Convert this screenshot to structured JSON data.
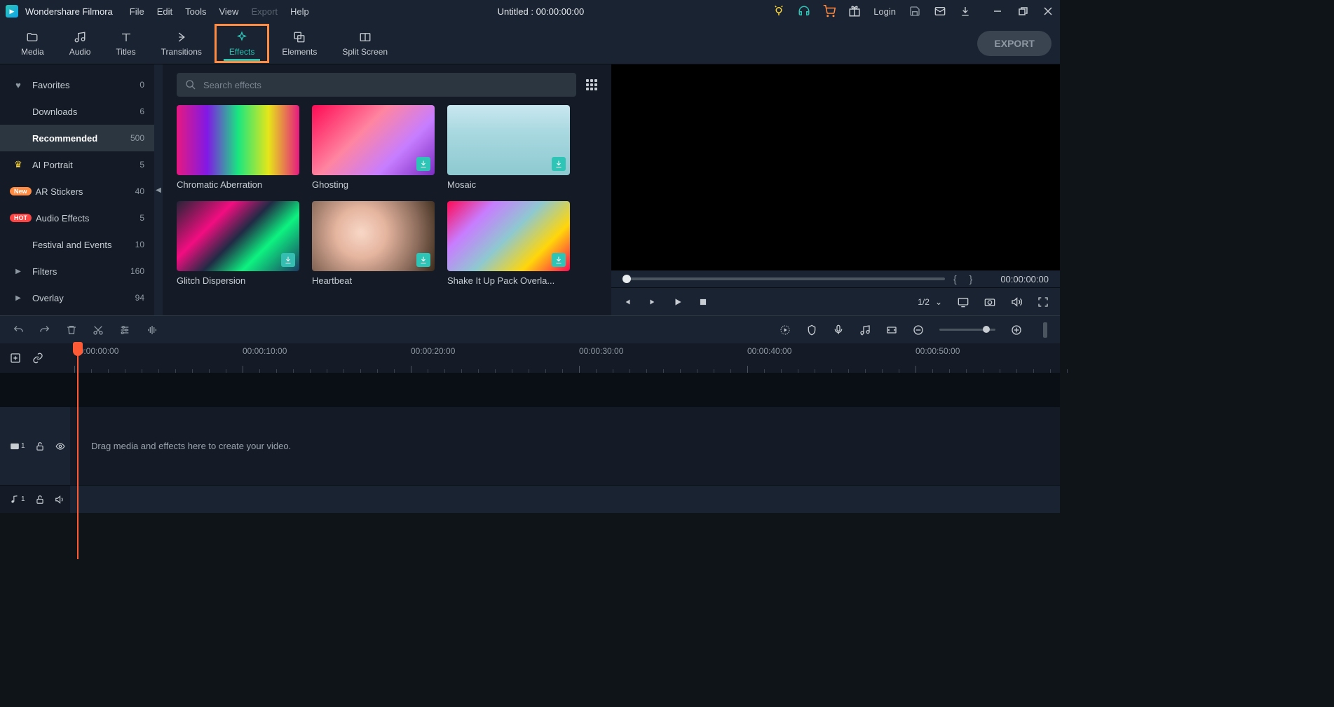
{
  "app": {
    "name": "Wondershare Filmora",
    "title": "Untitled : 00:00:00:00"
  },
  "menu": {
    "items": [
      "File",
      "Edit",
      "Tools",
      "View",
      "Export",
      "Help"
    ],
    "disabled_index": 4
  },
  "titlebar": {
    "login": "Login"
  },
  "tabs": [
    {
      "label": "Media",
      "icon": "folder"
    },
    {
      "label": "Audio",
      "icon": "music"
    },
    {
      "label": "Titles",
      "icon": "type"
    },
    {
      "label": "Transitions",
      "icon": "transitions"
    },
    {
      "label": "Effects",
      "icon": "sparkle",
      "active": true
    },
    {
      "label": "Elements",
      "icon": "layers"
    },
    {
      "label": "Split Screen",
      "icon": "split"
    }
  ],
  "export_label": "EXPORT",
  "sidebar": [
    {
      "icon": "heart",
      "label": "Favorites",
      "count": "0"
    },
    {
      "label": "Downloads",
      "count": "6"
    },
    {
      "label": "Recommended",
      "count": "500",
      "selected": true
    },
    {
      "icon": "crown",
      "label": "AI Portrait",
      "count": "5"
    },
    {
      "badge": "New",
      "badge_class": "new",
      "label": "AR Stickers",
      "count": "40"
    },
    {
      "badge": "HOT",
      "badge_class": "hot",
      "label": "Audio Effects",
      "count": "5"
    },
    {
      "label": "Festival and Events",
      "count": "10"
    },
    {
      "icon": "chevron",
      "label": "Filters",
      "count": "160"
    },
    {
      "icon": "chevron",
      "label": "Overlay",
      "count": "94"
    }
  ],
  "search": {
    "placeholder": "Search effects"
  },
  "effects": [
    {
      "label": "Chromatic Aberration",
      "thumb": "thumb-chromatic"
    },
    {
      "label": "Ghosting",
      "thumb": "thumb-ghosting",
      "download": true
    },
    {
      "label": "Mosaic",
      "thumb": "thumb-mosaic",
      "download": true
    },
    {
      "label": "Glitch Dispersion",
      "thumb": "thumb-glitch",
      "download": true
    },
    {
      "label": "Heartbeat",
      "thumb": "thumb-heartbeat",
      "download": true
    },
    {
      "label": "Shake It Up Pack Overla...",
      "thumb": "thumb-shake",
      "download": true
    }
  ],
  "preview": {
    "time": "00:00:00:00",
    "ratio": "1/2"
  },
  "timeline": {
    "ruler": [
      "00:00:00:00",
      "00:00:10:00",
      "00:00:20:00",
      "00:00:30:00",
      "00:00:40:00",
      "00:00:50:00"
    ],
    "drop_hint": "Drag media and effects here to create your video.",
    "video_track": "1",
    "audio_track": "1"
  }
}
